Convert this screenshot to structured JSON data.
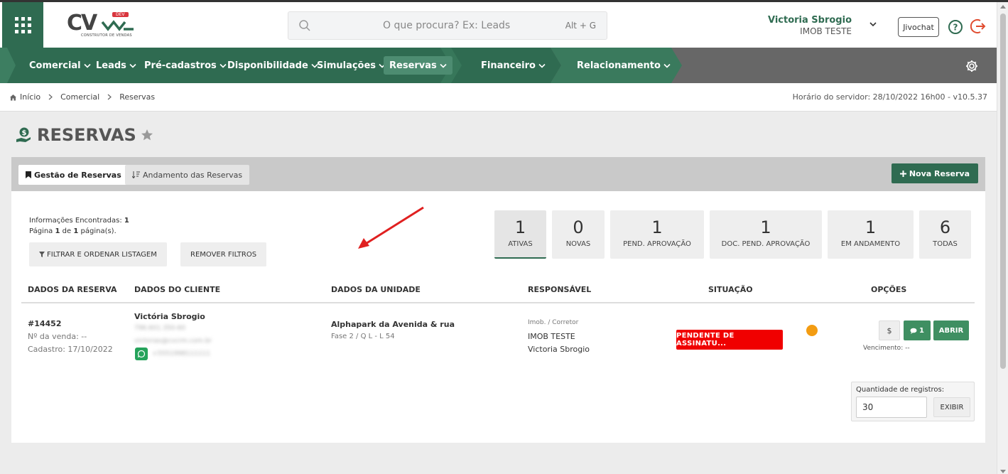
{
  "app": {
    "logo_text": "CV",
    "logo_badge": "DEV",
    "logo_sub": "CONSTRUTOR DE VENDAS"
  },
  "search": {
    "placeholder": "O que procura? Ex: Leads",
    "shortcut": "Alt + G"
  },
  "user": {
    "name": "Victoria Sbrogio",
    "company": "IMOB TESTE"
  },
  "header_actions": {
    "jivochat_label": "Jivochat"
  },
  "nav": {
    "items": [
      {
        "label": "Comercial"
      },
      {
        "label": "Leads"
      },
      {
        "label": "Pré-cadastros"
      },
      {
        "label": "Disponibilidade"
      },
      {
        "label": "Simulações"
      },
      {
        "label": "Reservas"
      },
      {
        "label": "Financeiro"
      },
      {
        "label": "Relacionamento"
      }
    ],
    "active": "Reservas"
  },
  "breadcrumb": {
    "items": [
      "Início",
      "Comercial",
      "Reservas"
    ],
    "server_time": "Horário do servidor: 28/10/2022 16h00 - v10.5.37"
  },
  "page": {
    "title": "RESERVAS"
  },
  "tabs": {
    "management": "Gestão de Reservas",
    "progress": "Andamento das Reservas"
  },
  "actions": {
    "new_reservation": "Nova Reserva",
    "filter_order": "FILTRAR E ORDENAR LISTAGEM",
    "remove_filters": "REMOVER FILTROS"
  },
  "info": {
    "found_label": "Informações Encontradas:",
    "found_count": "1",
    "page_prefix": "Página",
    "page_current": "1",
    "page_of": "de",
    "page_total": "1",
    "page_suffix": "página(s)."
  },
  "stats": [
    {
      "count": "1",
      "label": "ATIVAS"
    },
    {
      "count": "0",
      "label": "NOVAS"
    },
    {
      "count": "1",
      "label": "PEND. APROVAÇÃO"
    },
    {
      "count": "1",
      "label": "DOC. PEND. APROVAÇÃO"
    },
    {
      "count": "1",
      "label": "EM ANDAMENTO"
    },
    {
      "count": "6",
      "label": "TODAS"
    }
  ],
  "table": {
    "headers": [
      "DADOS DA RESERVA",
      "DADOS DO CLIENTE",
      "DADOS DA UNIDADE",
      "RESPONSÁVEL",
      "SITUAÇÃO",
      "OPÇÕES"
    ],
    "row": {
      "reservation_id": "#14452",
      "sale_number": "Nº da venda: --",
      "registered": "Cadastro: 17/10/2022",
      "client_name": "Victória Sbrogio",
      "client_doc": "796.601.350-60",
      "client_email": "victorias@cvcrm.com.br",
      "client_phone": "+5551998111111",
      "unit_name": "Alphapark da Avenida & rua",
      "unit_detail": "Fase 2 / Q L - L 54",
      "resp_role": "Imob. / Corretor",
      "resp_company": "IMOB TESTE",
      "resp_agent": "Victoria Sbrogio",
      "status": "PENDENTE DE ASSINATU...",
      "status_dot_color": "#f39c12",
      "money_label": "$",
      "comments_count": "1",
      "open_label": "ABRIR",
      "due": "Vencimento: --"
    }
  },
  "pagination": {
    "qty_label": "Quantidade de registros:",
    "qty_value": "30",
    "show_label": "EXIBIR"
  },
  "colors": {
    "brand": "#2f6b51",
    "status_red": "#f00000"
  }
}
